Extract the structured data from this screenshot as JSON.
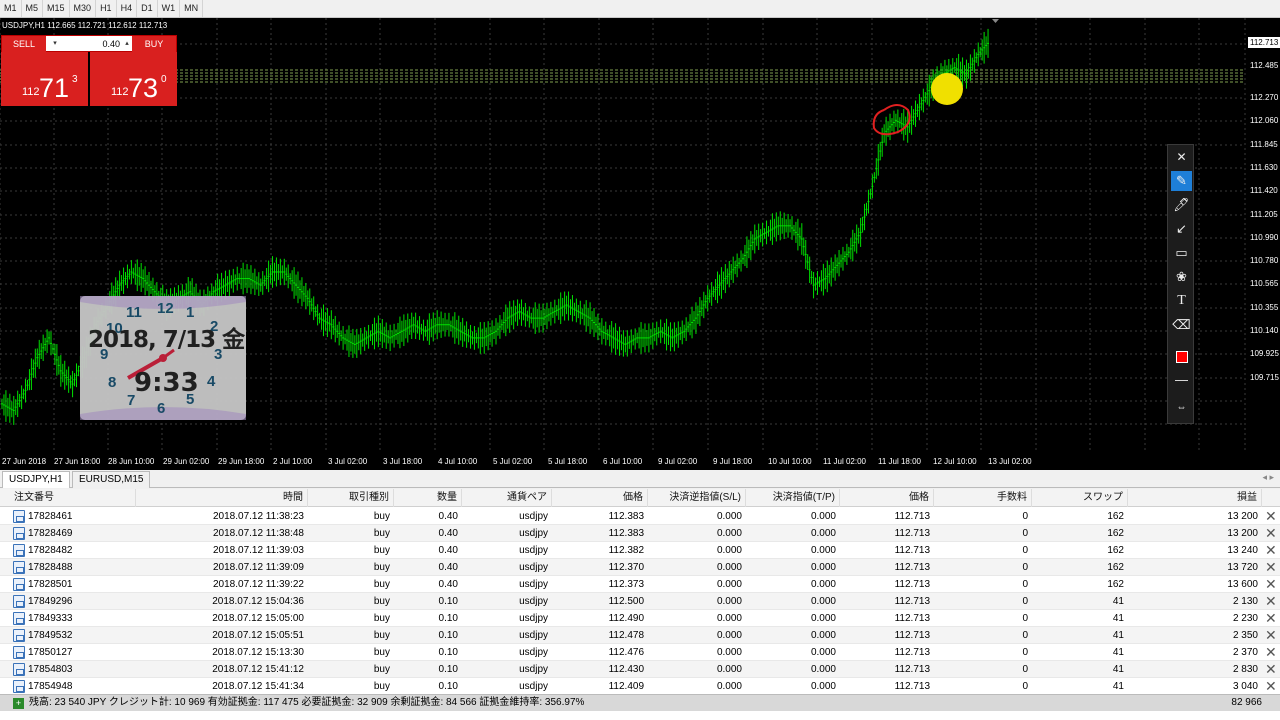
{
  "timeframes": [
    "M1",
    "M5",
    "M15",
    "M30",
    "H1",
    "H4",
    "D1",
    "W1",
    "MN"
  ],
  "chart": {
    "title": "USDJPY,H1  112.665 112.721 112.612 112.713",
    "current_price": "112.713",
    "price_labels": [
      "112.485",
      "112.270",
      "112.060",
      "111.845",
      "111.630",
      "111.420",
      "111.205",
      "110.990",
      "110.780",
      "110.565",
      "110.355",
      "110.140",
      "109.925",
      "109.715"
    ],
    "time_labels": [
      "27 Jun 2018",
      "27 Jun 18:00",
      "28 Jun 10:00",
      "29 Jun 02:00",
      "29 Jun 18:00",
      "2 Jul 10:00",
      "3 Jul 02:00",
      "3 Jul 18:00",
      "4 Jul 10:00",
      "5 Jul 02:00",
      "5 Jul 18:00",
      "6 Jul 10:00",
      "9 Jul 02:00",
      "9 Jul 18:00",
      "10 Jul 10:00",
      "11 Jul 02:00",
      "11 Jul 18:00",
      "12 Jul 10:00",
      "13 Jul 02:00"
    ],
    "colors": {
      "candle": "#00e000",
      "background": "#000000",
      "grid": "#3a3a3a",
      "sell_buy": "#d9201f"
    }
  },
  "chart_data": {
    "type": "line",
    "series": [
      {
        "values": [
          109.95,
          109.9,
          110.05,
          110.3,
          110.45,
          110.2,
          110.1,
          110.3,
          110.55,
          110.7,
          110.85,
          110.95,
          110.9,
          110.8,
          110.7,
          110.75,
          110.8,
          110.7,
          110.8,
          110.85,
          110.9,
          110.9,
          110.85,
          110.95,
          110.95,
          110.85,
          110.75,
          110.6,
          110.55,
          110.45,
          110.4,
          110.45,
          110.5,
          110.45,
          110.5,
          110.55,
          110.5,
          110.55,
          110.55,
          110.5,
          110.45,
          110.45,
          110.5,
          110.6,
          110.65,
          110.6,
          110.6,
          110.65,
          110.7,
          110.65,
          110.6,
          110.5,
          110.45,
          110.4,
          110.45,
          110.45,
          110.5,
          110.45,
          110.5,
          110.6,
          110.75,
          110.85,
          110.95,
          111.05,
          111.2,
          111.25,
          111.3,
          111.3,
          111.2,
          110.85,
          110.9,
          111.0,
          111.1,
          111.25,
          111.6,
          112.0,
          112.1,
          112.05,
          112.2,
          112.35,
          112.45,
          112.5,
          112.45,
          112.6,
          112.7
        ]
      }
    ],
    "ylim": [
      109.6,
      112.8
    ]
  },
  "one_click": {
    "sell": "SELL",
    "buy": "BUY",
    "lot": "0.40",
    "sell_prefix": "112",
    "sell_big": "71",
    "sell_sup": "3",
    "buy_prefix": "112",
    "buy_big": "73",
    "buy_sup": "0"
  },
  "clock": {
    "date": "2018, 7/13 金",
    "time": "9:33",
    "numbers": [
      "12",
      "1",
      "2",
      "3",
      "4",
      "5",
      "6",
      "7",
      "8",
      "9",
      "10",
      "11"
    ]
  },
  "chart_tabs": [
    "USDJPY,H1",
    "EURUSD,M15"
  ],
  "table": {
    "headers": [
      "注文番号",
      "時間",
      "取引種別",
      "数量",
      "通貨ペア",
      "価格",
      "決済逆指値(S/L)",
      "決済指値(T/P)",
      "価格",
      "手数料",
      "スワップ",
      "損益"
    ],
    "rows": [
      [
        "17828461",
        "2018.07.12 11:38:23",
        "buy",
        "0.40",
        "usdjpy",
        "112.383",
        "0.000",
        "0.000",
        "112.713",
        "0",
        "162",
        "13 200"
      ],
      [
        "17828469",
        "2018.07.12 11:38:48",
        "buy",
        "0.40",
        "usdjpy",
        "112.383",
        "0.000",
        "0.000",
        "112.713",
        "0",
        "162",
        "13 200"
      ],
      [
        "17828482",
        "2018.07.12 11:39:03",
        "buy",
        "0.40",
        "usdjpy",
        "112.382",
        "0.000",
        "0.000",
        "112.713",
        "0",
        "162",
        "13 240"
      ],
      [
        "17828488",
        "2018.07.12 11:39:09",
        "buy",
        "0.40",
        "usdjpy",
        "112.370",
        "0.000",
        "0.000",
        "112.713",
        "0",
        "162",
        "13 720"
      ],
      [
        "17828501",
        "2018.07.12 11:39:22",
        "buy",
        "0.40",
        "usdjpy",
        "112.373",
        "0.000",
        "0.000",
        "112.713",
        "0",
        "162",
        "13 600"
      ],
      [
        "17849296",
        "2018.07.12 15:04:36",
        "buy",
        "0.10",
        "usdjpy",
        "112.500",
        "0.000",
        "0.000",
        "112.713",
        "0",
        "41",
        "2 130"
      ],
      [
        "17849333",
        "2018.07.12 15:05:00",
        "buy",
        "0.10",
        "usdjpy",
        "112.490",
        "0.000",
        "0.000",
        "112.713",
        "0",
        "41",
        "2 230"
      ],
      [
        "17849532",
        "2018.07.12 15:05:51",
        "buy",
        "0.10",
        "usdjpy",
        "112.478",
        "0.000",
        "0.000",
        "112.713",
        "0",
        "41",
        "2 350"
      ],
      [
        "17850127",
        "2018.07.12 15:13:30",
        "buy",
        "0.10",
        "usdjpy",
        "112.476",
        "0.000",
        "0.000",
        "112.713",
        "0",
        "41",
        "2 370"
      ],
      [
        "17854803",
        "2018.07.12 15:41:12",
        "buy",
        "0.10",
        "usdjpy",
        "112.430",
        "0.000",
        "0.000",
        "112.713",
        "0",
        "41",
        "2 830"
      ],
      [
        "17854948",
        "2018.07.12 15:41:34",
        "buy",
        "0.10",
        "usdjpy",
        "112.409",
        "0.000",
        "0.000",
        "112.713",
        "0",
        "41",
        "3 040"
      ]
    ]
  },
  "status": {
    "text": "残高: 23 540 JPY  クレジット計: 10 969  有効証拠金: 117 475  必要証拠金: 32 909  余剰証拠金: 84 566  証拠金維持率: 356.97%",
    "total": "82 966"
  },
  "drawing_tools": [
    "pencil-icon",
    "marker-icon",
    "arrow-icon",
    "rectangle-icon",
    "stamp-icon",
    "text-icon",
    "eraser-icon",
    "color-swatch",
    "line-width-icon",
    "expand-icon"
  ]
}
